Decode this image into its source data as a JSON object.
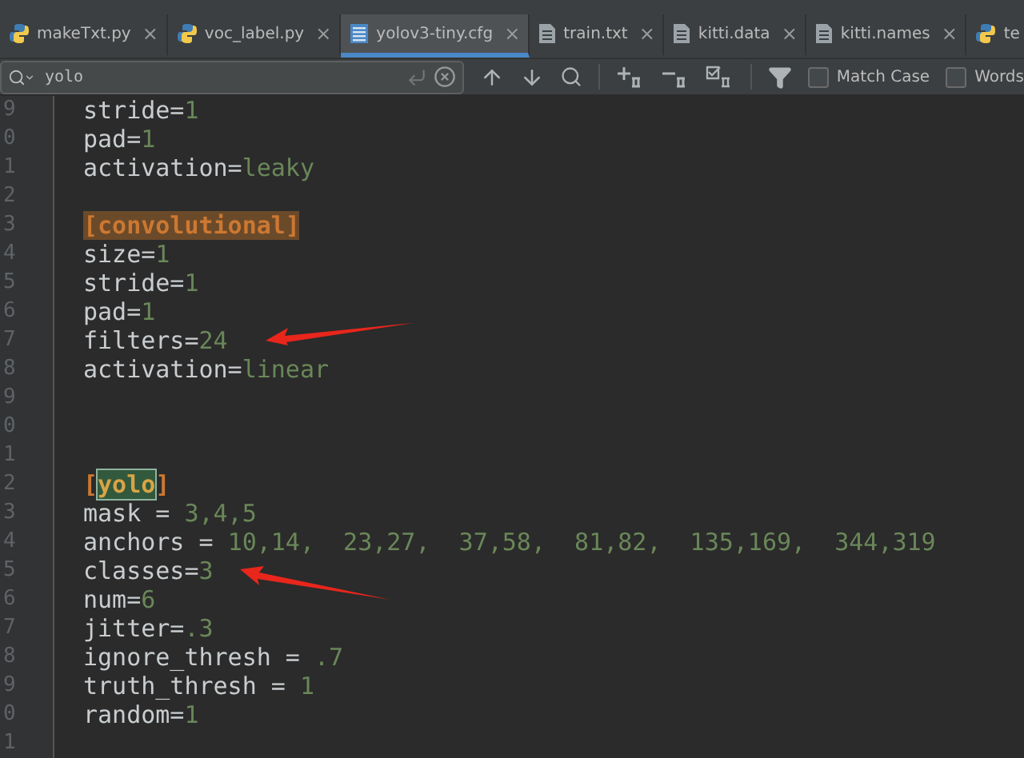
{
  "tabs": [
    {
      "label": "makeTxt.py",
      "kind": "python",
      "selected": false,
      "close": "×"
    },
    {
      "label": "voc_label.py",
      "kind": "python",
      "selected": false,
      "close": "×"
    },
    {
      "label": "yolov3-tiny.cfg",
      "kind": "config",
      "selected": true,
      "close": "×"
    },
    {
      "label": "train.txt",
      "kind": "text",
      "selected": false,
      "close": "×"
    },
    {
      "label": "kitti.data",
      "kind": "text",
      "selected": false,
      "close": "×"
    },
    {
      "label": "kitti.names",
      "kind": "text",
      "selected": false,
      "close": "×"
    },
    {
      "label": "te",
      "kind": "python",
      "selected": false
    }
  ],
  "search": {
    "value": "yolo",
    "options": [
      {
        "label": "Match Case",
        "checked": false
      },
      {
        "label": "Words",
        "checked": false
      }
    ]
  },
  "editor": {
    "lines": [
      {
        "number": "9",
        "segments": [
          {
            "kind": "key",
            "text": "stride="
          },
          {
            "kind": "value",
            "text": "1"
          }
        ]
      },
      {
        "number": "0",
        "segments": [
          {
            "kind": "key",
            "text": "pad="
          },
          {
            "kind": "value",
            "text": "1"
          }
        ]
      },
      {
        "number": "1",
        "segments": [
          {
            "kind": "key",
            "text": "activation="
          },
          {
            "kind": "value",
            "text": "leaky"
          }
        ]
      },
      {
        "number": "2"
      },
      {
        "number": "3",
        "segments": [
          {
            "kind": "highlight",
            "text": "[convolutional]"
          }
        ]
      },
      {
        "number": "4",
        "segments": [
          {
            "kind": "key",
            "text": "size="
          },
          {
            "kind": "value",
            "text": "1"
          }
        ]
      },
      {
        "number": "5",
        "segments": [
          {
            "kind": "key",
            "text": "stride="
          },
          {
            "kind": "value",
            "text": "1"
          }
        ]
      },
      {
        "number": "6",
        "segments": [
          {
            "kind": "key",
            "text": "pad="
          },
          {
            "kind": "value",
            "text": "1"
          }
        ]
      },
      {
        "number": "7",
        "segments": [
          {
            "kind": "key",
            "text": "filters="
          },
          {
            "kind": "value",
            "text": "24"
          }
        ],
        "arrow": true
      },
      {
        "number": "8",
        "segments": [
          {
            "kind": "key",
            "text": "activation="
          },
          {
            "kind": "value",
            "text": "linear"
          }
        ]
      },
      {
        "number": "9"
      },
      {
        "number": "0"
      },
      {
        "number": "1"
      },
      {
        "number": "2",
        "segments": [
          {
            "kind": "section",
            "text": "["
          },
          {
            "kind": "match",
            "text": "yolo"
          },
          {
            "kind": "section",
            "text": "]"
          }
        ]
      },
      {
        "number": "3",
        "segments": [
          {
            "kind": "key",
            "text": "mask = "
          },
          {
            "kind": "value",
            "text": "3,4,5"
          }
        ]
      },
      {
        "number": "4",
        "segments": [
          {
            "kind": "key",
            "text": "anchors = "
          },
          {
            "kind": "value",
            "text": "10,14,  23,27,  37,58,  81,82,  135,169,  344,319"
          }
        ]
      },
      {
        "number": "5",
        "segments": [
          {
            "kind": "key",
            "text": "classes="
          },
          {
            "kind": "value",
            "text": "3"
          }
        ],
        "arrow": true
      },
      {
        "number": "6",
        "segments": [
          {
            "kind": "key",
            "text": "num="
          },
          {
            "kind": "value",
            "text": "6"
          }
        ]
      },
      {
        "number": "7",
        "segments": [
          {
            "kind": "key",
            "text": "jitter="
          },
          {
            "kind": "value",
            "text": ".3"
          }
        ]
      },
      {
        "number": "8",
        "segments": [
          {
            "kind": "key",
            "text": "ignore_thresh = "
          },
          {
            "kind": "value",
            "text": ".7"
          }
        ]
      },
      {
        "number": "9",
        "segments": [
          {
            "kind": "key",
            "text": "truth_thresh = "
          },
          {
            "kind": "value",
            "text": "1"
          }
        ]
      },
      {
        "number": "0",
        "segments": [
          {
            "kind": "key",
            "text": "random="
          },
          {
            "kind": "value",
            "text": "1"
          }
        ]
      },
      {
        "number": "1"
      }
    ]
  }
}
